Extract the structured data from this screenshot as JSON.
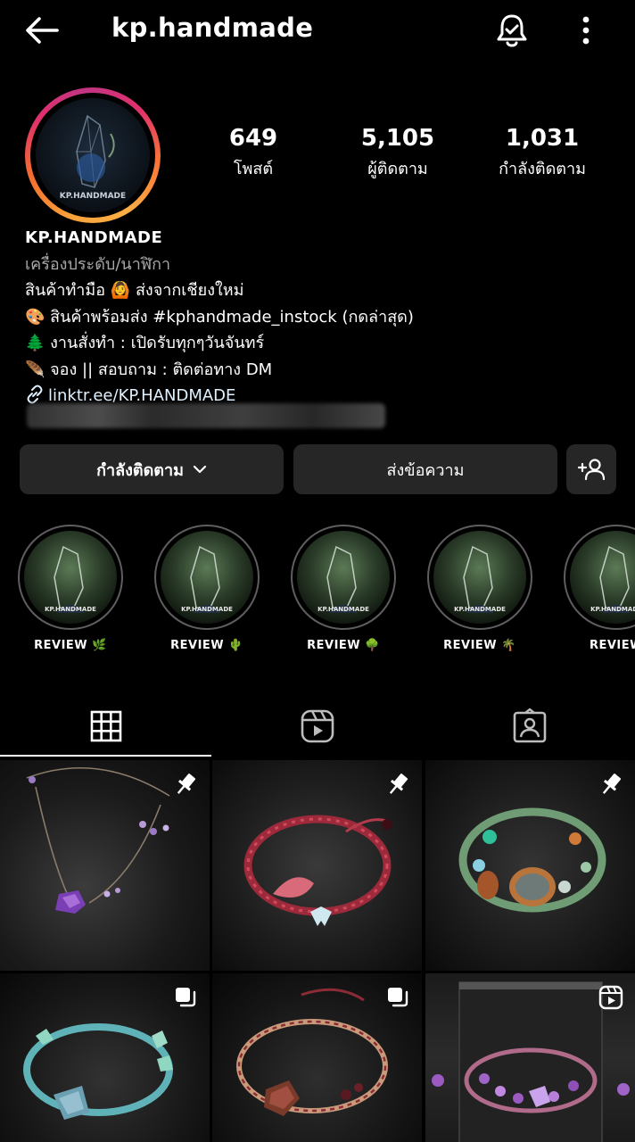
{
  "header": {
    "username": "kp.handmade"
  },
  "stats": [
    {
      "value": "649",
      "label": "โพสต์"
    },
    {
      "value": "5,105",
      "label": "ผู้ติดตาม"
    },
    {
      "value": "1,031",
      "label": "กำลังติดตาม"
    }
  ],
  "bio": {
    "name": "KP.HANDMADE",
    "category": "เครื่องประดับ/นาฬิกา",
    "lines": [
      "สินค้าทำมือ 🙆 ส่งจากเชียงใหม่",
      "🎨 สินค้าพร้อมส่ง #kphandmade_instock (กดล่าสุด)",
      "🌲 งานสั่งทำ : เปิดรับทุกๆวันจันทร์",
      "🪶 จอง || สอบถาม : ติดต่อทาง DM"
    ],
    "link": "linktr.ee/KP.HANDMADE"
  },
  "buttons": {
    "following": "กำลังติดตาม",
    "message": "ส่งข้อความ"
  },
  "highlights": [
    {
      "label": "REVIEW 🌿"
    },
    {
      "label": "REVIEW 🌵"
    },
    {
      "label": "REVIEW 🌳"
    },
    {
      "label": "REVIEW 🌴"
    },
    {
      "label": "REVIEW"
    }
  ],
  "avatar_text": "KP.HANDMADE",
  "tabs": [
    "grid-icon",
    "reels-icon",
    "tagged-icon"
  ],
  "posts": [
    {
      "type": "pinned",
      "theme": "amethyst-necklace"
    },
    {
      "type": "pinned",
      "theme": "red-bracelet"
    },
    {
      "type": "pinned",
      "theme": "green-bracelet"
    },
    {
      "type": "carousel",
      "theme": "aqua-bracelet"
    },
    {
      "type": "carousel",
      "theme": "garnet-bracelet"
    },
    {
      "type": "reel",
      "theme": "purple-bracelet"
    }
  ]
}
